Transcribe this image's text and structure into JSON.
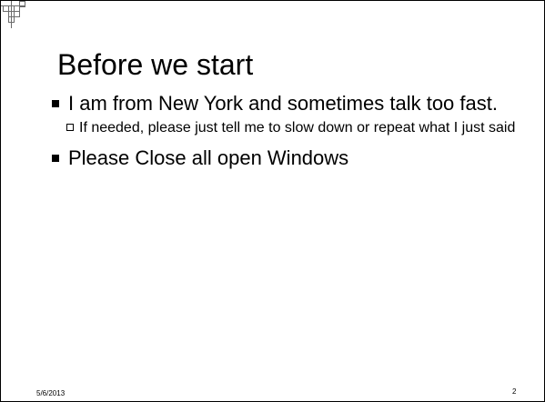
{
  "slide": {
    "title": "Before we start",
    "bullets": [
      {
        "text": "I am from New York and sometimes talk too fast.",
        "subbullets": [
          {
            "text": "If needed, please just tell me to slow down or repeat what I just said"
          }
        ]
      },
      {
        "text": "Please Close all open Windows",
        "subbullets": []
      }
    ],
    "footer": {
      "date": "5/6/2013",
      "page_number": "2"
    },
    "decor": {
      "logo_icon": "grid-squares-logo-icon",
      "bullet_icon": "filled-square-bullet-icon",
      "subbullet_icon": "hollow-square-bullet-icon"
    }
  }
}
